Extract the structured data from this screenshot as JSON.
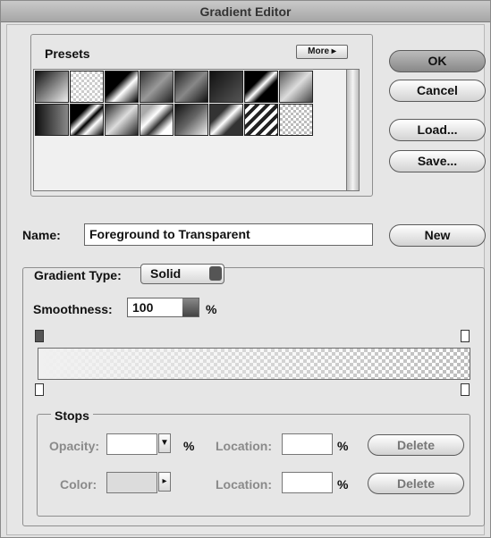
{
  "window": {
    "title": "Gradient Editor"
  },
  "presets": {
    "legend": "Presets",
    "more_label": "More ▸"
  },
  "buttons": {
    "ok": "OK",
    "cancel": "Cancel",
    "load": "Load...",
    "save": "Save...",
    "new": "New",
    "delete_opacity": "Delete",
    "delete_color": "Delete"
  },
  "name_field": {
    "label": "Name:",
    "value": "Foreground to Transparent"
  },
  "gradient_type": {
    "label": "Gradient Type:",
    "value": "Solid"
  },
  "smoothness": {
    "label": "Smoothness:",
    "value": "100",
    "unit": "%"
  },
  "stops": {
    "legend": "Stops",
    "opacity_label": "Opacity:",
    "opacity_unit": "%",
    "location_label_1": "Location:",
    "location_unit_1": "%",
    "color_label": "Color:",
    "location_label_2": "Location:",
    "location_unit_2": "%"
  }
}
